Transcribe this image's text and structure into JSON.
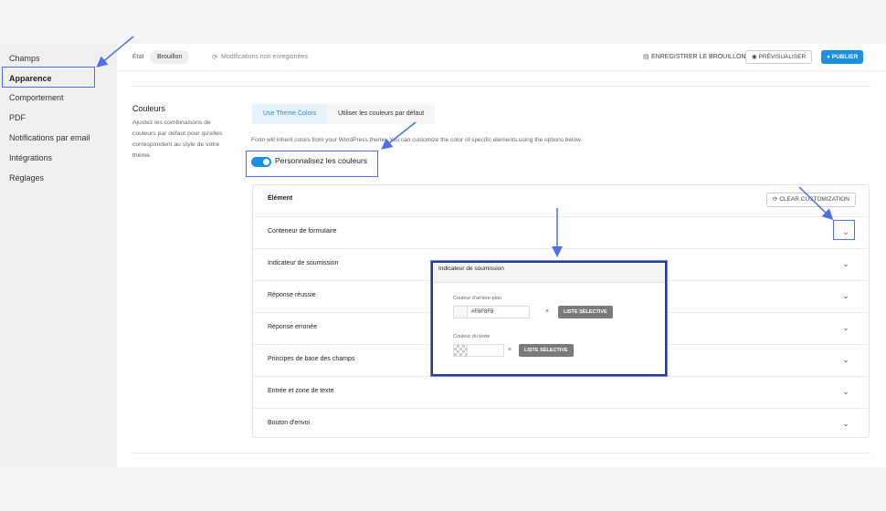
{
  "sidebar": {
    "items": [
      {
        "label": "Champs"
      },
      {
        "label": "Apparence"
      },
      {
        "label": "Comportement"
      },
      {
        "label": "PDF"
      },
      {
        "label": "Notifications par email"
      },
      {
        "label": "Intégrations"
      },
      {
        "label": "Réglages"
      }
    ],
    "active_index": 1
  },
  "header": {
    "state_label": "État",
    "state_value": "Brouillon",
    "unsaved_text": "Modifications non enregistrées",
    "save_draft_label": "ENREGISTRER LE BROUILLON",
    "preview_label": "PRÉVISUALISER",
    "publish_label": "PUBLIER"
  },
  "section": {
    "title": "Couleurs",
    "description": "Ajustez les combinaisons de couleurs par défaut pour qu'elles correspondent au style de votre thème.",
    "tabs": [
      {
        "label": "Use Theme Colors",
        "active": true
      },
      {
        "label": "Utiliser les couleurs par défaut",
        "active": false
      }
    ],
    "note": "Form will inherit colors from your WordPress theme. You can customize the color of specific elements using the options below.",
    "toggle_label": "Personnalisez les couleurs",
    "toggle_on": true
  },
  "table": {
    "header_label": "Élément",
    "clear_label": "CLEAR CUSTOMIZATION",
    "rows": [
      {
        "label": "Conteneur de formulaire"
      },
      {
        "label": "Indicateur de soumission"
      },
      {
        "label": "Réponse réussie"
      },
      {
        "label": "Réponse erronée"
      },
      {
        "label": "Principes de base des champs"
      },
      {
        "label": "Entrée et zone de texte"
      },
      {
        "label": "Bouton d'envoi"
      }
    ]
  },
  "popup": {
    "title": "Indicateur de soumission",
    "bg_label": "Couleur d'arrière-plan",
    "bg_value": "#F8F8F8",
    "text_label": "Couleur du texte",
    "text_value": "",
    "picker_label": "LISTE SÉLECTIVE",
    "clear_glyph": "×"
  },
  "colors": {
    "accent": "#1d8fe0",
    "annotation": "#4f6ee8",
    "popup_border": "#2b3a8f"
  }
}
